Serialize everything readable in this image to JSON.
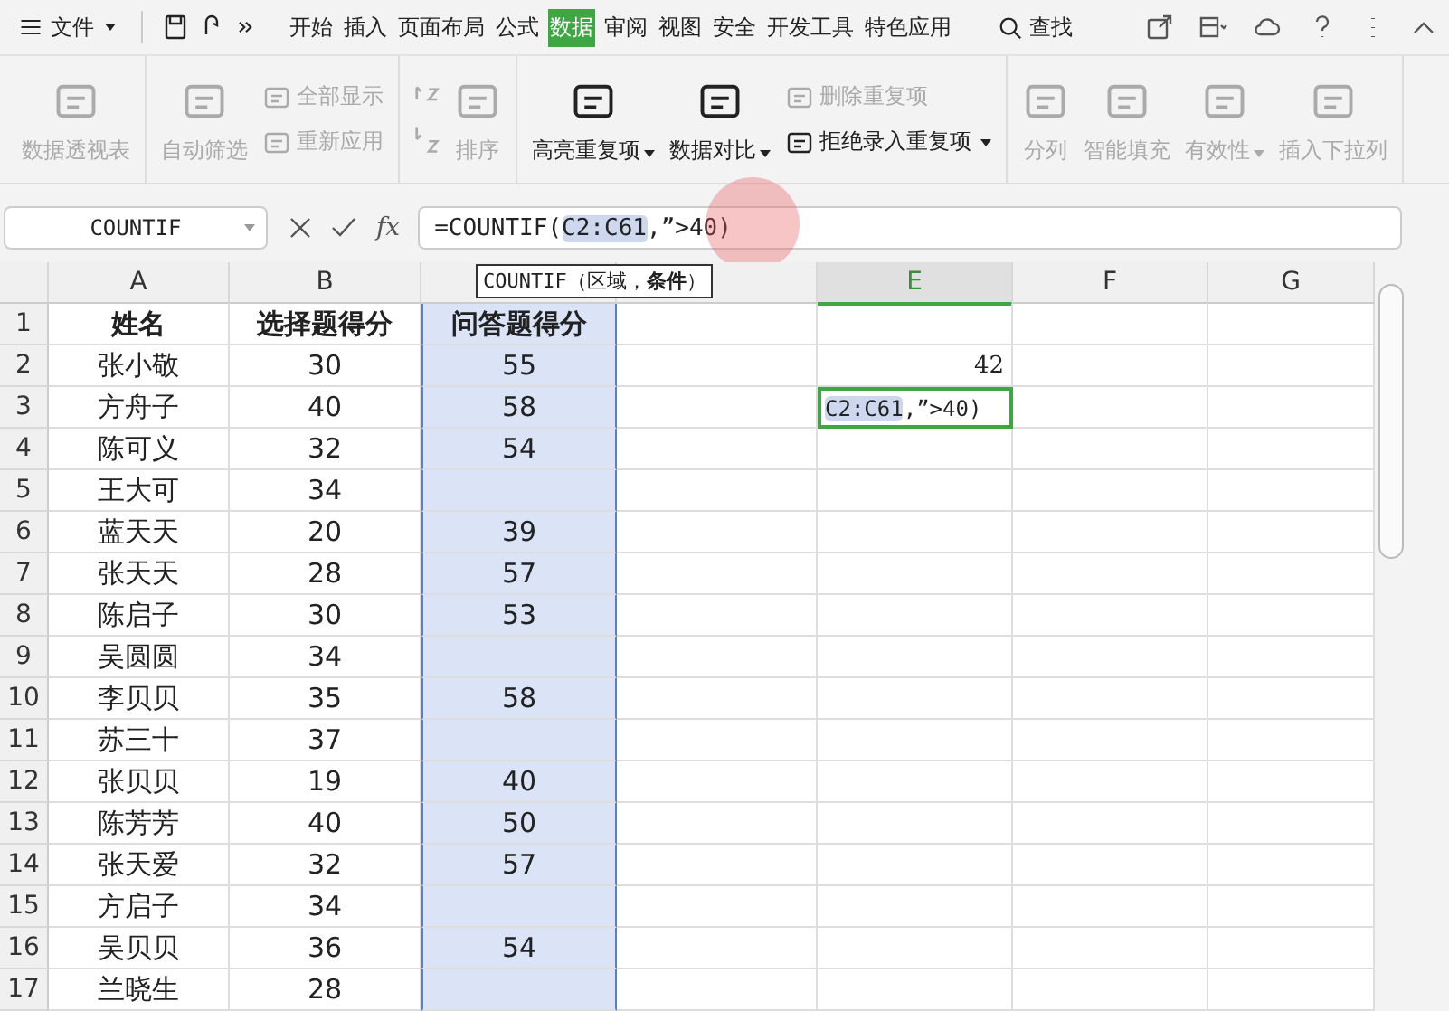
{
  "menu": {
    "file": "文件",
    "tabs": [
      {
        "label": "开始",
        "selected": false
      },
      {
        "label": "插入",
        "selected": false
      },
      {
        "label": "页面布局",
        "selected": false
      },
      {
        "label": "公式",
        "selected": false
      },
      {
        "label": "数据",
        "selected": true
      },
      {
        "label": "审阅",
        "selected": false
      },
      {
        "label": "视图",
        "selected": false
      },
      {
        "label": "安全",
        "selected": false
      },
      {
        "label": "开发工具",
        "selected": false
      },
      {
        "label": "特色应用",
        "selected": false
      }
    ],
    "search": "查找"
  },
  "ribbon": {
    "groups": [
      [
        [
          {
            "kind": "big",
            "label": "数据透视表",
            "disabled": true,
            "dropdown": false
          }
        ]
      ],
      [
        [
          {
            "kind": "big",
            "label": "自动筛选",
            "disabled": true,
            "dropdown": false
          }
        ],
        [
          {
            "kind": "small",
            "label": "全部显示",
            "disabled": true,
            "dropdown": false
          },
          {
            "kind": "small",
            "label": "重新应用",
            "disabled": true,
            "dropdown": false
          }
        ]
      ],
      [
        [
          {
            "kind": "sort",
            "disabled": true
          }
        ],
        [
          {
            "kind": "big",
            "label": "排序",
            "disabled": true,
            "dropdown": false
          }
        ]
      ],
      [
        [
          {
            "kind": "big",
            "label": "高亮重复项",
            "disabled": false,
            "dropdown": true
          }
        ],
        [
          {
            "kind": "big",
            "label": "数据对比",
            "disabled": false,
            "dropdown": true
          }
        ],
        [
          {
            "kind": "small",
            "label": "删除重复项",
            "disabled": true,
            "dropdown": false
          },
          {
            "kind": "small",
            "label": "拒绝录入重复项",
            "disabled": false,
            "dropdown": true
          }
        ]
      ],
      [
        [
          {
            "kind": "big",
            "label": "分列",
            "disabled": true,
            "dropdown": false
          }
        ],
        [
          {
            "kind": "big",
            "label": "智能填充",
            "disabled": true,
            "dropdown": false
          }
        ],
        [
          {
            "kind": "big",
            "label": "有效性",
            "disabled": true,
            "dropdown": true
          }
        ],
        [
          {
            "kind": "big",
            "label": "插入下拉列",
            "disabled": true,
            "dropdown": false
          }
        ]
      ]
    ]
  },
  "formula_bar": {
    "name_box": "COUNTIF",
    "fx": "fx",
    "formula_prefix": "=COUNTIF(",
    "formula_range": "C2:C61",
    "formula_suffix": ",”>40)"
  },
  "cell_editor": {
    "range": "C2:C61",
    "suffix": ",”>40)"
  },
  "tooltip": "COUNTIF（区域，**条件**）",
  "columns": [
    {
      "label": "A",
      "selected": false
    },
    {
      "label": "B",
      "selected": false
    },
    {
      "selected": false
    },
    {
      "selected": false
    },
    {
      "label": "E",
      "selected": true
    },
    {
      "label": "F",
      "selected": false
    },
    {
      "label": "G",
      "selected": false
    }
  ],
  "rows": [
    {
      "num": "1",
      "cells": [
        "姓名",
        "选择题得分",
        "问答题得分"
      ]
    },
    {
      "num": "2",
      "cells": [
        "张小敬",
        "30",
        "55"
      ],
      "e": "42"
    },
    {
      "num": "3",
      "cells": [
        "方舟子",
        "40",
        "58"
      ],
      "editing": true
    },
    {
      "num": "4",
      "cells": [
        "陈可义",
        "32",
        "54"
      ]
    },
    {
      "num": "5",
      "cells": [
        "王大可",
        "34"
      ]
    },
    {
      "num": "6",
      "cells": [
        "蓝天天",
        "20",
        "39"
      ]
    },
    {
      "num": "7",
      "cells": [
        "张天天",
        "28",
        "57"
      ]
    },
    {
      "num": "8",
      "cells": [
        "陈启子",
        "30",
        "53"
      ]
    },
    {
      "num": "9",
      "cells": [
        "吴圆圆",
        "34"
      ]
    },
    {
      "num": "10",
      "cells": [
        "李贝贝",
        "35",
        "58"
      ]
    },
    {
      "num": "11",
      "cells": [
        "苏三十",
        "37"
      ]
    },
    {
      "num": "12",
      "cells": [
        "张贝贝",
        "19",
        "40"
      ]
    },
    {
      "num": "13",
      "cells": [
        "陈芳芳",
        "40",
        "50"
      ]
    },
    {
      "num": "14",
      "cells": [
        "张天爱",
        "32",
        "57"
      ]
    },
    {
      "num": "15",
      "cells": [
        "方启子",
        "34"
      ]
    },
    {
      "num": "16",
      "cells": [
        "吴贝贝",
        "36",
        "54"
      ]
    },
    {
      "num": "17",
      "cells": [
        "兰晓生",
        "28"
      ]
    }
  ]
}
